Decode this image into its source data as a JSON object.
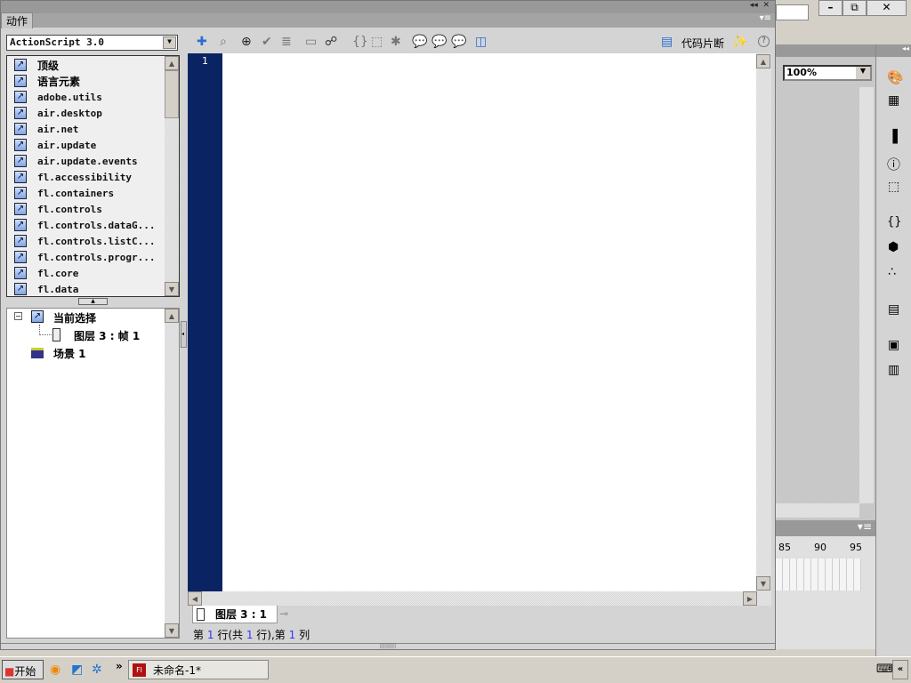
{
  "panel": {
    "tab": "动作",
    "language": "ActionScript 3.0",
    "code_snippets": "代码片断"
  },
  "toolbox": {
    "items": [
      "顶级",
      "语言元素",
      "adobe.utils",
      "air.desktop",
      "air.net",
      "air.update",
      "air.update.events",
      "fl.accessibility",
      "fl.containers",
      "fl.controls",
      "fl.controls.dataG...",
      "fl.controls.listC...",
      "fl.controls.progr...",
      "fl.core",
      "fl.data"
    ]
  },
  "tree": {
    "current": "当前选择",
    "frame": "图层 3 : 帧 1",
    "scene": "场景 1"
  },
  "editor": {
    "line_number": "1",
    "script_tab": "图层 3 : 1"
  },
  "status": {
    "p1": "第",
    "line": "1",
    "p2": "行(共",
    "total": "1",
    "p3": "行),第",
    "p4": "第",
    "col": "1",
    "p5": "列"
  },
  "stage": {
    "zoom": "100%"
  },
  "timeline": {
    "frames": [
      "85",
      "90",
      "95"
    ]
  },
  "taskbar": {
    "start": "开始",
    "task": "未命名-1*",
    "chevron": "»"
  },
  "colors": {
    "line_gutter": "#0a2463",
    "panel_bg": "#d4d4d4"
  }
}
